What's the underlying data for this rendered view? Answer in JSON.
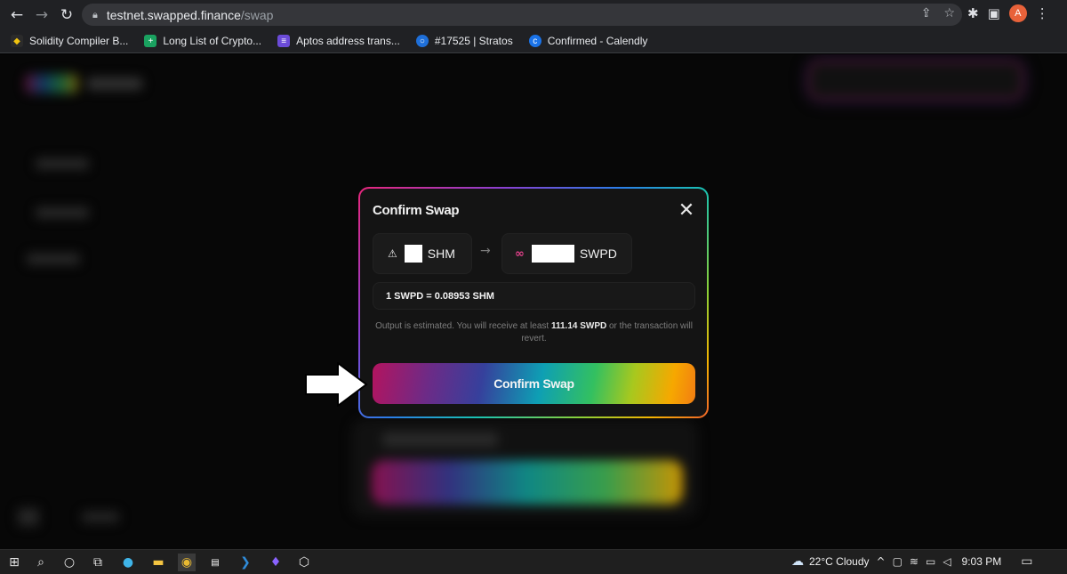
{
  "browser": {
    "url_host": "testnet.swapped.finance",
    "url_path": "/swap",
    "profile_initial": "A",
    "bookmarks": [
      {
        "label": "Solidity Compiler B...",
        "color": "#1b1b1b"
      },
      {
        "label": "Long List of Crypto...",
        "color": "#1aa260"
      },
      {
        "label": "Aptos address trans...",
        "color": "#6b4bd8"
      },
      {
        "label": "#17525 | Stratos",
        "color": "#1e6fd9"
      },
      {
        "label": "Confirmed - Calendly",
        "color": "#1a73e8"
      }
    ]
  },
  "modal": {
    "title": "Confirm Swap",
    "from_token": {
      "symbol": "SHM",
      "icon": "shardeum-icon"
    },
    "to_token": {
      "symbol": "SWPD",
      "icon": "swapped-icon"
    },
    "rate": "1 SWPD = 0.08953 SHM",
    "note_prefix": "Output is estimated. You will receive at least ",
    "note_amount": "111.14 SWPD",
    "note_suffix": " or the transaction will revert.",
    "confirm_label": "Confirm Swap"
  },
  "taskbar": {
    "weather": "22°C  Cloudy",
    "time": "9:03 PM"
  },
  "colors": {
    "accent_pink": "#b3145f",
    "accent_teal": "#0e9fb4",
    "accent_orange": "#f27d12"
  }
}
